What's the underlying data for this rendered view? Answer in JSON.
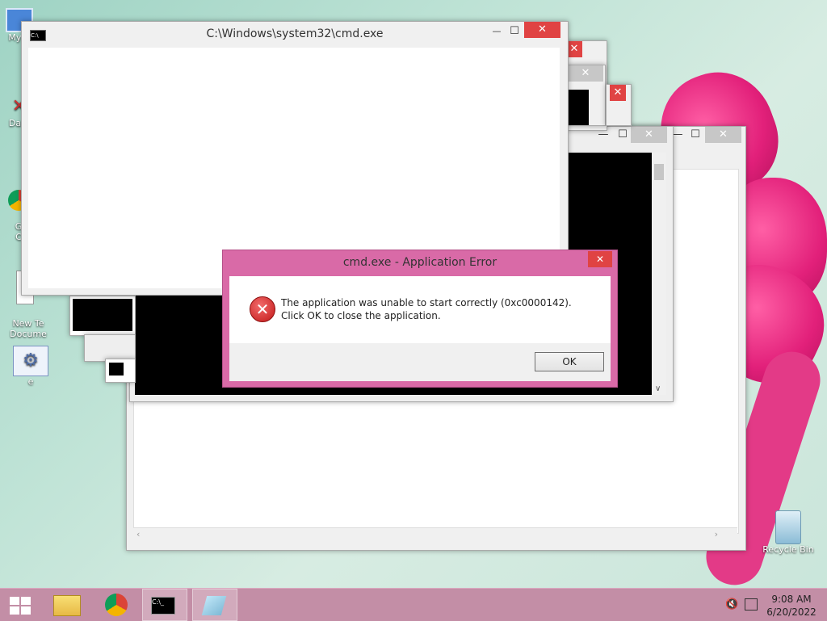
{
  "desktop": {
    "icons": [
      {
        "label": "My C",
        "icon": "computer-icon"
      },
      {
        "label": "Data",
        "icon": "database-icon"
      },
      {
        "label": "G\nC",
        "icon": "chrome-icon"
      },
      {
        "label": "New Te\nDocume",
        "icon": "text-document-icon"
      },
      {
        "label": "e",
        "icon": "settings-app-icon"
      },
      {
        "label": "Recycle Bin",
        "icon": "recycle-bin-icon"
      }
    ]
  },
  "main_window": {
    "title": "C:\\Windows\\system32\\cmd.exe",
    "minimize": "—",
    "maximize": "☐",
    "close": "✕"
  },
  "dialog": {
    "title": "cmd.exe - Application Error",
    "close": "✕",
    "message": "The application was unable to start correctly (0xc0000142). Click OK to close the application.",
    "ok_label": "OK"
  },
  "taskbar": {
    "time": "9:08 AM",
    "date": "6/20/2022",
    "items": [
      "start-button",
      "file-explorer-icon",
      "chrome-icon",
      "cmd-icon",
      "notepad-icon"
    ]
  },
  "colors": {
    "dialog_frame": "#d96aa7",
    "taskbar": "#c38ea6",
    "close_red": "#e04343"
  }
}
